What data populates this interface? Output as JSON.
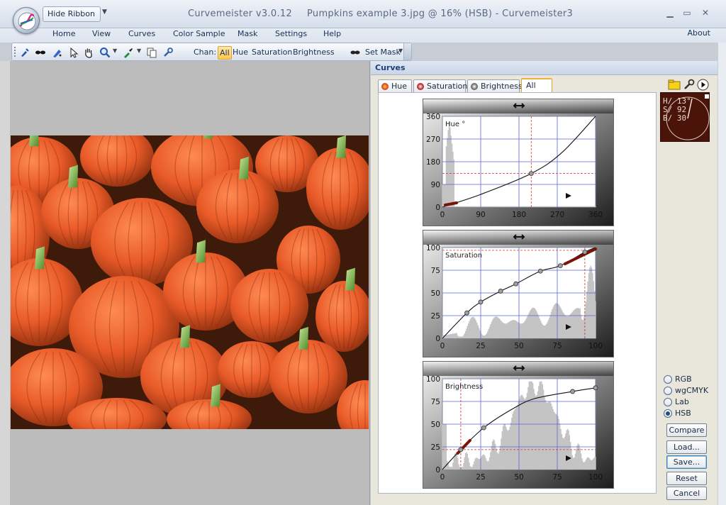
{
  "window": {
    "app_title": "Curvemeister v3.0.12",
    "doc_title": "Pumpkins example 3.jpg @ 16% (HSB) - Curvemeister3",
    "hide_ribbon_label": "Hide Ribbon",
    "minimize": "▁",
    "maximize": "▭",
    "close": "✕"
  },
  "menu": {
    "items": [
      "Home",
      "View",
      "Curves",
      "Color Sample",
      "Mask",
      "Settings",
      "Help"
    ],
    "about": "About"
  },
  "toolbar": {
    "chan_label": "Chan:",
    "channels": [
      "All",
      "Hue",
      "Saturation",
      "Brightness"
    ],
    "active_channel": "All",
    "set_mask_label": "Set Mask",
    "icons": [
      "eyedropper-add-icon",
      "mask-glasses-icon",
      "pen-tool-icon",
      "arrow-pointer-icon",
      "hand-pan-icon",
      "zoom-icon",
      "color-picker-icon",
      "copy-icon",
      "wrench-icon"
    ]
  },
  "curves_panel": {
    "title": "Curves",
    "tabs": [
      {
        "label": "Hue",
        "color": "#cc3a2a"
      },
      {
        "label": "Saturation",
        "color": "#b02c2c"
      },
      {
        "label": "Brightness",
        "color": "#777777"
      },
      {
        "label": "All",
        "color": ""
      }
    ],
    "active_tab": "All",
    "graphs": [
      {
        "name": "Hue °",
        "y_ticks": [
          "360",
          "270",
          "180",
          "90",
          "0"
        ],
        "x_ticks": [
          "0",
          "90",
          "180",
          "270",
          "360"
        ],
        "range": [
          0,
          360
        ]
      },
      {
        "name": "Saturation",
        "y_ticks": [
          "100",
          "75",
          "50",
          "25",
          "0"
        ],
        "x_ticks": [
          "0",
          "25",
          "50",
          "75",
          "100"
        ],
        "range": [
          0,
          100
        ]
      },
      {
        "name": "Brightness",
        "y_ticks": [
          "100",
          "75",
          "50",
          "25",
          "0"
        ],
        "x_ticks": [
          "0",
          "25",
          "50",
          "75",
          "100"
        ],
        "range": [
          0,
          100
        ]
      }
    ],
    "readout": {
      "h": "H/ 13°",
      "s": "S/ 92",
      "b": "B/ 30",
      "bg_color": "#4a1408"
    },
    "color_spaces": [
      "RGB",
      "wgCMYK",
      "Lab",
      "HSB"
    ],
    "selected_space": "HSB",
    "buttons": [
      "Compare",
      "Load...",
      "Save...",
      "Reset",
      "Cancel"
    ]
  }
}
